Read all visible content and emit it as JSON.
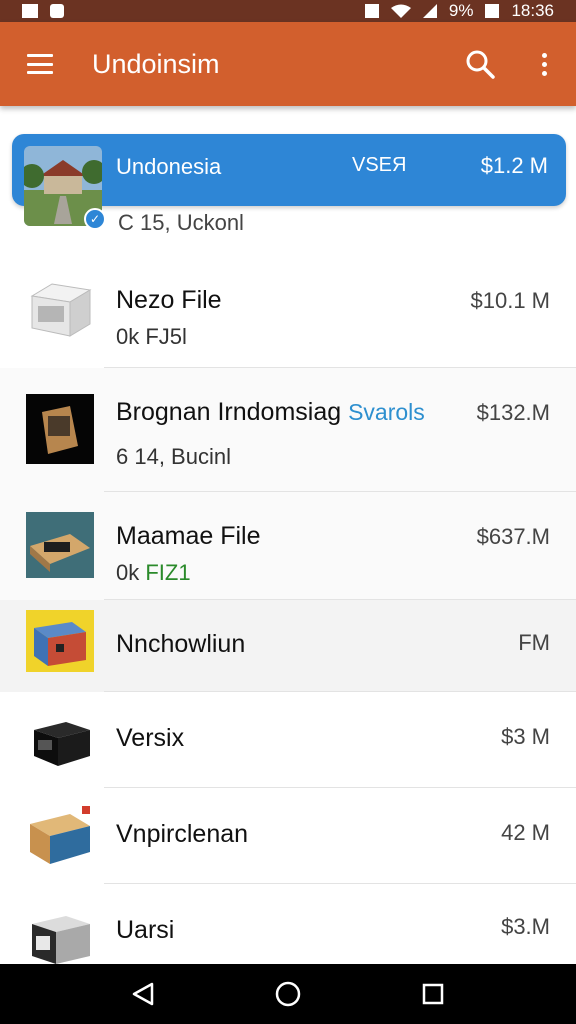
{
  "status_bar": {
    "battery": "9%",
    "time": "18:36"
  },
  "app_bar": {
    "title": "Undoinsim"
  },
  "selected_item": {
    "name": "Undonesia",
    "tag": "VSEЯ",
    "price": "$1.2 M",
    "subtitle": "C 15, Uckonl"
  },
  "items": [
    {
      "title": "Nezo File",
      "subtitle": "0k FJ5l",
      "price": "$10.1 M"
    },
    {
      "title": "Brognan Irndomsiag",
      "tag": "Svarols",
      "subtitle": "6  14, Bucinl",
      "price": "$132.M"
    },
    {
      "title": "Maamae File",
      "subtitle_a": "0k ",
      "subtitle_b": "FIZ1",
      "price": "$637.M"
    },
    {
      "title": "Nnchowliun",
      "price": "FM"
    },
    {
      "title": "Versix",
      "price": "$3 M"
    },
    {
      "title": "Vnpirclenan",
      "price": "42 M"
    },
    {
      "title": "Uarsi",
      "price": "$3.M"
    }
  ],
  "colors": {
    "app_bar": "#d25f2d",
    "selected": "#2e86d6",
    "status_bar": "#6b3322"
  }
}
